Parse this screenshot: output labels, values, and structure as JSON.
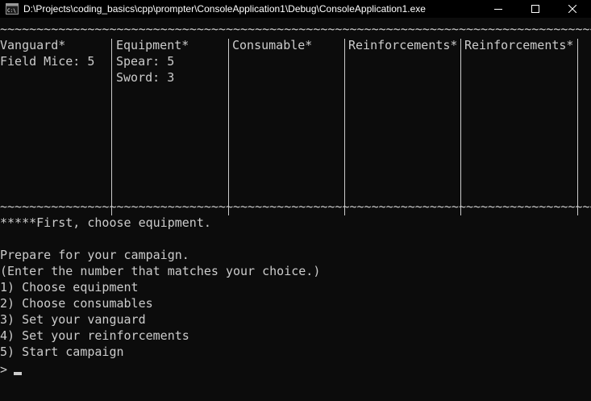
{
  "window": {
    "title": "D:\\Projects\\coding_basics\\cpp\\prompter\\ConsoleApplication1\\Debug\\ConsoleApplication1.exe",
    "minimize_icon": "minimize-icon",
    "maximize_icon": "maximize-icon",
    "close_icon": "close-icon",
    "app_icon": "console-app-icon"
  },
  "console": {
    "tilde_row": "~~~~~~~~~~~~~~~~~~~~~~~~~~~~~~~~~~~~~~~~~~~~~~~~~~~~~~~~~~~~~~~~~~~~~~~~~~~~~~~~~~~~~~~~~~~~~~~~~~~~~~~~~~~~~~~~~~~~~~~~~~~~~~~~~~~~~~~~~~~~~~",
    "columns": [
      {
        "header": "Vanguard*",
        "rows": [
          "Field Mice: 5"
        ]
      },
      {
        "header": "Equipment*",
        "rows": [
          "Spear: 5",
          "Sword: 3"
        ]
      },
      {
        "header": "Consumable*",
        "rows": []
      },
      {
        "header": "Reinforcements*",
        "rows": []
      },
      {
        "header": "Reinforcements*",
        "rows": []
      }
    ],
    "hint": "*****First, choose equipment.",
    "prompt_title": "Prepare for your campaign.",
    "instruction": "(Enter the number that matches your choice.)",
    "options": [
      "1) Choose equipment",
      "2) Choose consumables",
      "3) Set your vanguard",
      "4) Set your reinforcements",
      "5) Start campaign"
    ],
    "input_prompt": ">",
    "input_value": ""
  },
  "colors": {
    "background": "#0c0c0c",
    "text": "#cccccc",
    "titlebar": "#000000"
  }
}
